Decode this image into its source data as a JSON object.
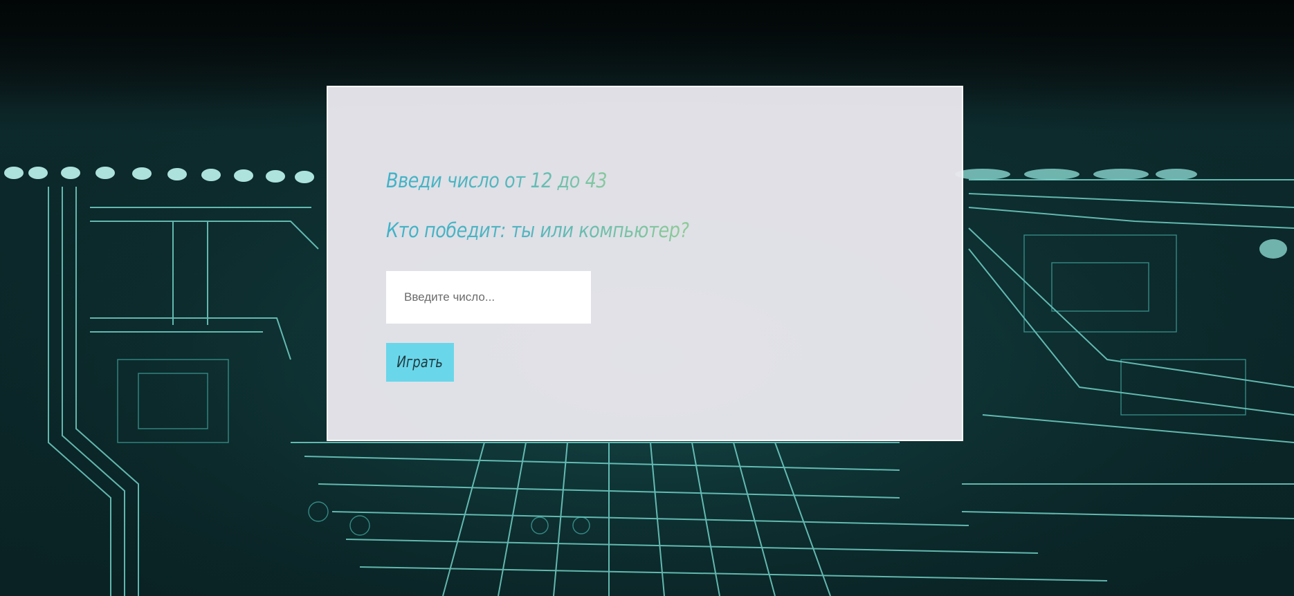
{
  "game": {
    "heading": "Введи число от 12 до 43",
    "subheading": "Кто победит: ты или компьютер?",
    "input_placeholder": "Введите число...",
    "input_value": "",
    "play_button_label": "Играть"
  },
  "colors": {
    "panel_background": "#ecebf0",
    "heading_gradient_start": "#3fb2c8",
    "heading_gradient_end": "#87c89e",
    "button_background": "#6ad6ea",
    "background_glow": "#5ee3d8"
  }
}
